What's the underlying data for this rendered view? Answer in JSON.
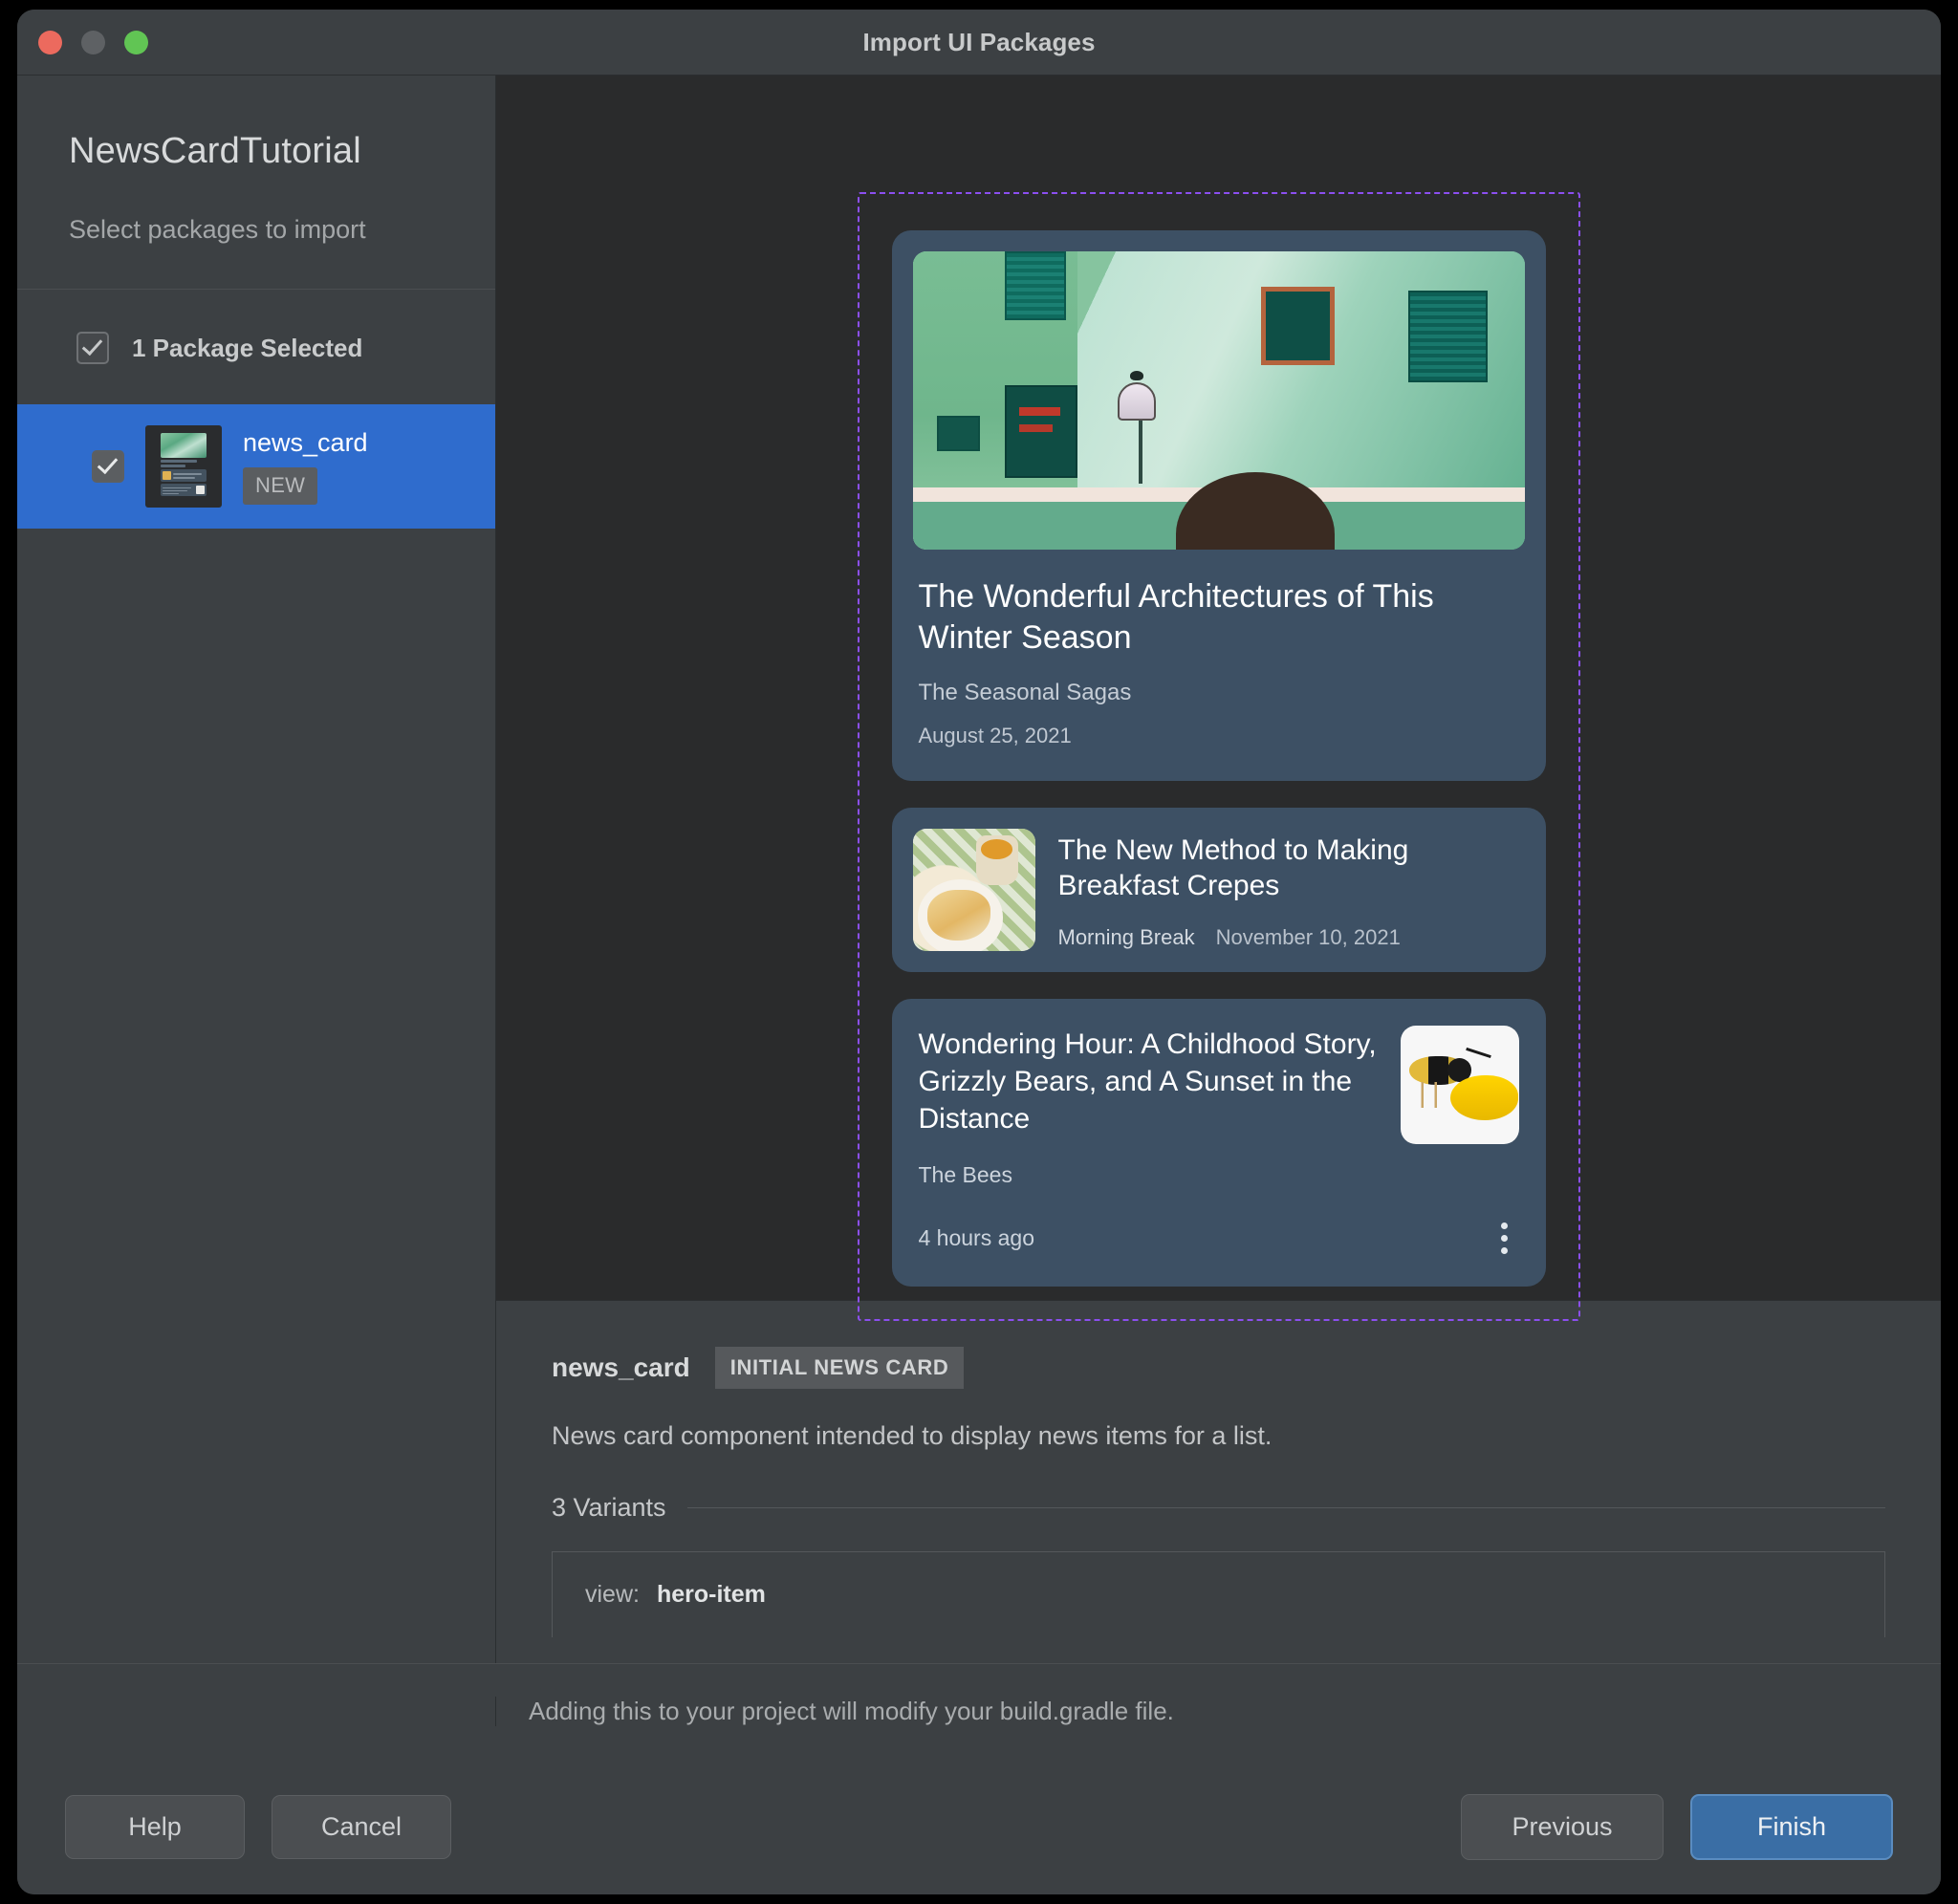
{
  "window": {
    "title": "Import UI Packages",
    "traffic_lights": [
      "close-red",
      "minimize-gray",
      "zoom-green"
    ]
  },
  "sidebar": {
    "project_title": "NewsCardTutorial",
    "subtitle": "Select packages to import",
    "select_all": {
      "label": "1 Package Selected",
      "checked": true
    },
    "packages": [
      {
        "name": "news_card",
        "badge": "NEW",
        "checked": true,
        "selected": true,
        "thumbnail": "news-card-preview-thumbnail"
      }
    ]
  },
  "preview": {
    "selection_border_color": "#8c4ff0",
    "cards": [
      {
        "layout": "hero-item",
        "title": "The Wonderful Architectures of This Winter Season",
        "source": "The Seasonal Sagas",
        "date": "August 25, 2021",
        "image": "green-building-facade-photo"
      },
      {
        "layout": "list-item",
        "title": "The New Method to Making Breakfast Crepes",
        "source": "Morning Break",
        "date": "November 10, 2021",
        "image": "breakfast-crepes-photo"
      },
      {
        "layout": "detail-item",
        "title": "Wondering Hour: A Childhood Story, Grizzly Bears, and A Sunset in the Distance",
        "source": "The Bees",
        "time": "4 hours ago",
        "image": "bee-on-yellow-photo",
        "overflow_menu": "more-options"
      }
    ]
  },
  "details": {
    "name": "news_card",
    "tag": "INITIAL NEWS CARD",
    "description": "News card component intended to display news items for a list.",
    "variants_label": "3 Variants",
    "variants": [
      {
        "key": "view:",
        "value": "hero-item"
      }
    ]
  },
  "footnote": {
    "text": "Adding this to your project will modify your build.gradle file."
  },
  "footer": {
    "help_label": "Help",
    "cancel_label": "Cancel",
    "previous_label": "Previous",
    "finish_label": "Finish",
    "finish_accent_color": "#3a6ea5"
  }
}
